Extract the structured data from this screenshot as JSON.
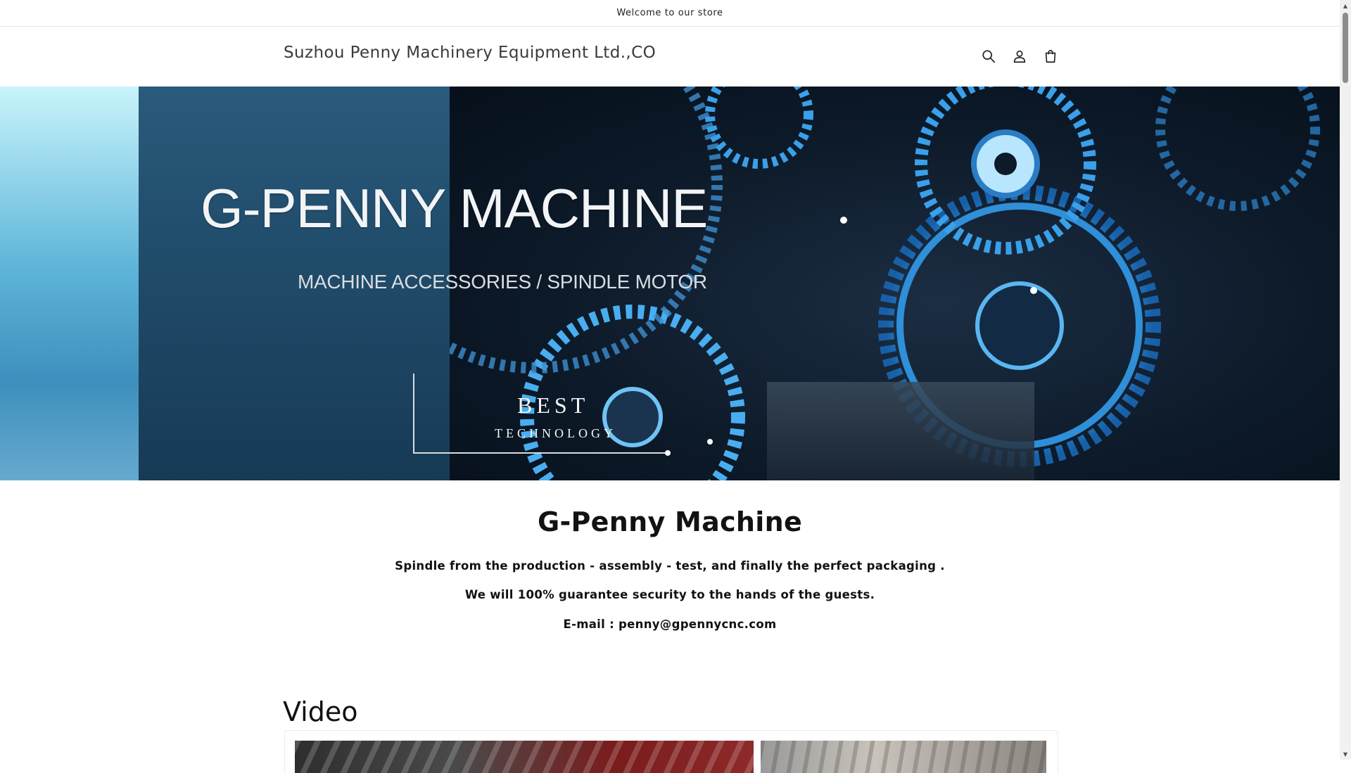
{
  "announcement": "Welcome to our store",
  "header": {
    "brand": "Suzhou Penny Machinery Equipment Ltd.,CO",
    "icons": [
      "search-icon",
      "account-icon",
      "cart-icon"
    ]
  },
  "hero": {
    "title": "G-PENNY  MACHINE",
    "subtitle": "MACHINE ACCESSORIES / SPINDLE MOTOR",
    "badge_line1": "BEST",
    "badge_line2": "TECHNOLOGY"
  },
  "intro": {
    "heading": "G-Penny Machine",
    "line1": "Spindle from the production - assembly - test, and finally the perfect packaging .",
    "line2": "We will 100% guarantee security to the hands of the guests.",
    "line3": "E-mail : penny@gpennycnc.com"
  },
  "video": {
    "heading": "Video"
  },
  "colors": {
    "text": "#121212",
    "brand_text": "#3a3a3a",
    "hero_blue": "#2a5a7c",
    "gear_blue": "#3aa0ea"
  }
}
